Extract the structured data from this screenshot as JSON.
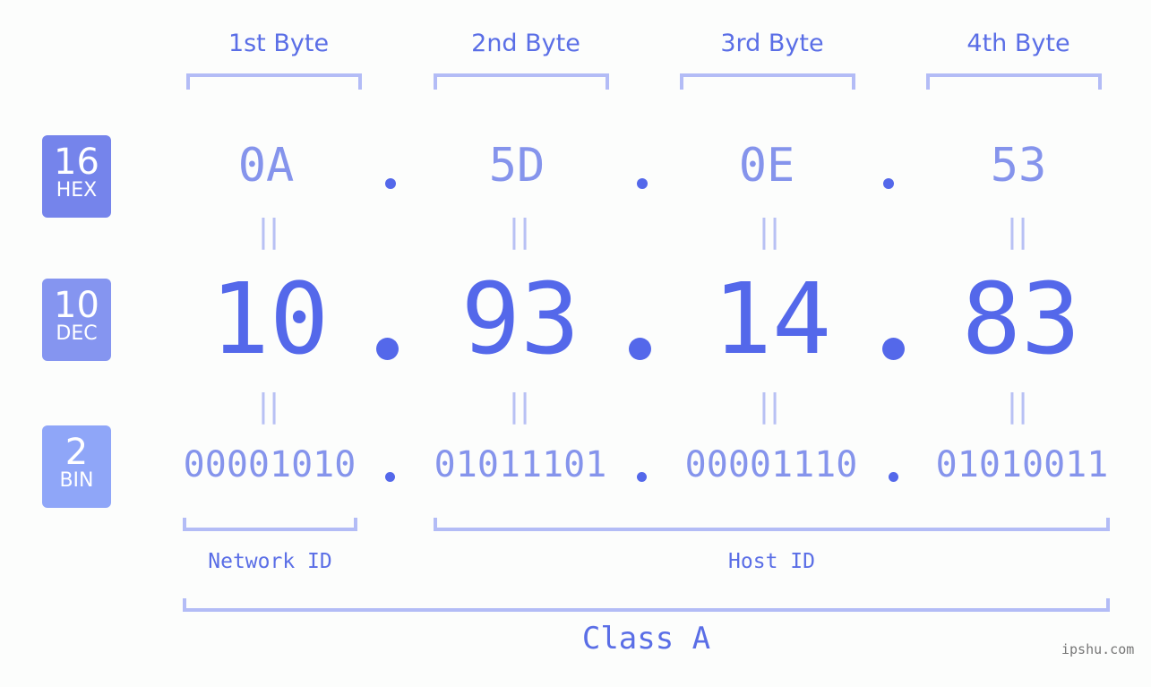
{
  "bytes": [
    {
      "title": "1st Byte",
      "hex": "0A",
      "dec": "10",
      "bin": "00001010"
    },
    {
      "title": "2nd Byte",
      "hex": "5D",
      "dec": "93",
      "bin": "01011101"
    },
    {
      "title": "3rd Byte",
      "hex": "0E",
      "dec": "14",
      "bin": "00001110"
    },
    {
      "title": "4th Byte",
      "hex": "53",
      "dec": "83",
      "bin": "01010011"
    }
  ],
  "badges": {
    "hex": {
      "num": "16",
      "label": "HEX",
      "color": "#7584eb"
    },
    "dec": {
      "num": "10",
      "label": "DEC",
      "color": "#8595f0"
    },
    "bin": {
      "num": "2",
      "label": "BIN",
      "color": "#8fa6f8"
    }
  },
  "equals_symbol": "||",
  "network_id_label": "Network ID",
  "host_id_label": "Host ID",
  "class_label": "Class A",
  "watermark": "ipshu.com",
  "colors": {
    "accent": "#5468ea",
    "light_accent": "#8594ec",
    "bracket": "#b3bcf6"
  }
}
